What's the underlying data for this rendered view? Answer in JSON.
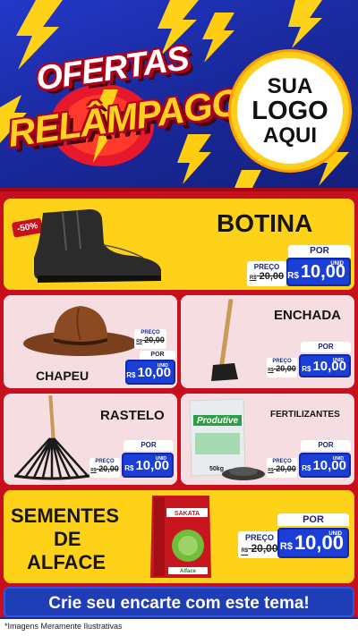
{
  "header": {
    "title_line1": "OFERTAS",
    "title_line2": "RELÂMPAGO",
    "logo_line1": "SUA",
    "logo_line2": "LOGO",
    "logo_line3": "AQUI"
  },
  "colors": {
    "primary_red": "#c7101c",
    "yellow": "#ffd21a",
    "blue": "#1b3fd6",
    "pink_card": "#f6dde2"
  },
  "products": {
    "botina": {
      "name": "BOTINA",
      "discount_badge": "-50%",
      "preco_label": "PREÇO",
      "old_price": "20,00",
      "old_prefix": "R$",
      "por_label": "POR",
      "currency": "R$",
      "price": "10,00",
      "unit": "UNID",
      "icon": "boot-icon"
    },
    "chapeu": {
      "name": "CHAPEU",
      "preco_label": "PREÇO",
      "old_price": "20,00",
      "old_prefix": "R$",
      "por_label": "POR",
      "currency": "R$",
      "price": "10,00",
      "unit": "UNID",
      "icon": "hat-icon"
    },
    "enchada": {
      "name": "ENCHADA",
      "preco_label": "PREÇO",
      "old_price": "20,00",
      "old_prefix": "R$",
      "por_label": "POR",
      "currency": "R$",
      "price": "10,00",
      "unit": "UNID",
      "icon": "hoe-icon"
    },
    "rastelo": {
      "name": "RASTELO",
      "preco_label": "PREÇO",
      "old_price": "20,00",
      "old_prefix": "R$",
      "por_label": "POR",
      "currency": "R$",
      "price": "10,00",
      "unit": "UNID",
      "icon": "rake-icon"
    },
    "fertilizantes": {
      "name": "FERTILIZANTES",
      "bag_brand": "Produtive",
      "bag_weight": "50kg",
      "preco_label": "PREÇO",
      "old_price": "20,00",
      "old_prefix": "R$",
      "por_label": "POR",
      "currency": "R$",
      "price": "10,00",
      "unit": "UNID",
      "icon": "fertilizer-bag-icon"
    },
    "sementes": {
      "name_line1": "SEMENTES",
      "name_line2": "DE",
      "name_line3": "ALFACE",
      "pack_brand": "SAKATA",
      "pack_label": "Alface",
      "preco_label": "PREÇO",
      "old_price": "20,00",
      "old_prefix": "R$",
      "por_label": "POR",
      "currency": "R$",
      "price": "10,00",
      "unit": "UNID",
      "icon": "seed-packet-icon"
    }
  },
  "cta": {
    "label": "Crie seu encarte com este tema!"
  },
  "footer": {
    "disclaimer": "*Imagens Meramente Ilustrativas"
  }
}
